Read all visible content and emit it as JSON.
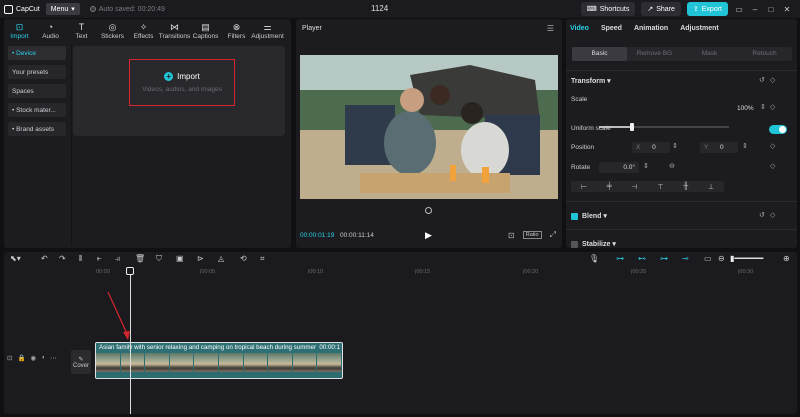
{
  "titlebar": {
    "app_name": "CapCut",
    "menu_label": "Menu",
    "autosave_text": "Auto saved: 00:20:49",
    "project_title": "1124",
    "shortcuts_label": "Shortcuts",
    "share_label": "Share",
    "export_label": "Export"
  },
  "media": {
    "tabs": [
      {
        "label": "Import",
        "icon": "import-icon"
      },
      {
        "label": "Audio",
        "icon": "audio-icon"
      },
      {
        "label": "Text",
        "icon": "text-icon"
      },
      {
        "label": "Stickers",
        "icon": "stickers-icon"
      },
      {
        "label": "Effects",
        "icon": "effects-icon"
      },
      {
        "label": "Transitions",
        "icon": "transitions-icon"
      },
      {
        "label": "Captions",
        "icon": "captions-icon"
      },
      {
        "label": "Filters",
        "icon": "filters-icon"
      },
      {
        "label": "Adjustment",
        "icon": "adjustment-icon"
      }
    ],
    "side_items": [
      "• Device",
      "Your presets",
      "Spaces",
      "• Stock mater...",
      "• Brand assets"
    ],
    "import_label": "Import",
    "import_sub": "Videos, audios, and images"
  },
  "player": {
    "title": "Player",
    "current_time": "00:00:01:19",
    "total_time": "00:00:11:14",
    "ratio_label": "Ratio"
  },
  "details": {
    "tabs": [
      "Video",
      "Speed",
      "Animation",
      "Adjustment"
    ],
    "subtabs": [
      "Basic",
      "Remove BG",
      "Mask",
      "Retouch"
    ],
    "transform_label": "Transform",
    "scale_label": "Scale",
    "scale_value": "100%",
    "scale_level": 0.25,
    "uniform_scale_label": "Uniform scale",
    "position_label": "Position",
    "pos_x_label": "X",
    "pos_x_value": "0",
    "pos_y_label": "Y",
    "pos_y_value": "0",
    "rotate_label": "Rotate",
    "rotate_value": "0.0°",
    "blend_label": "Blend",
    "stabilize_label": "Stabilize"
  },
  "timeline": {
    "ruler_labels": [
      "00:00",
      "|00:05",
      "|00:10",
      "|00:15",
      "|00:20",
      "|00:25",
      "|00:30"
    ],
    "cover_label": "Cover",
    "clip_title": "Asian family with senior relaxing and camping on tropical beach during summer",
    "clip_duration": "00:00:1"
  },
  "colors": {
    "accent": "#21c4d6",
    "highlight_box": "#d6262e",
    "clip_bg": "#2d6e72"
  }
}
